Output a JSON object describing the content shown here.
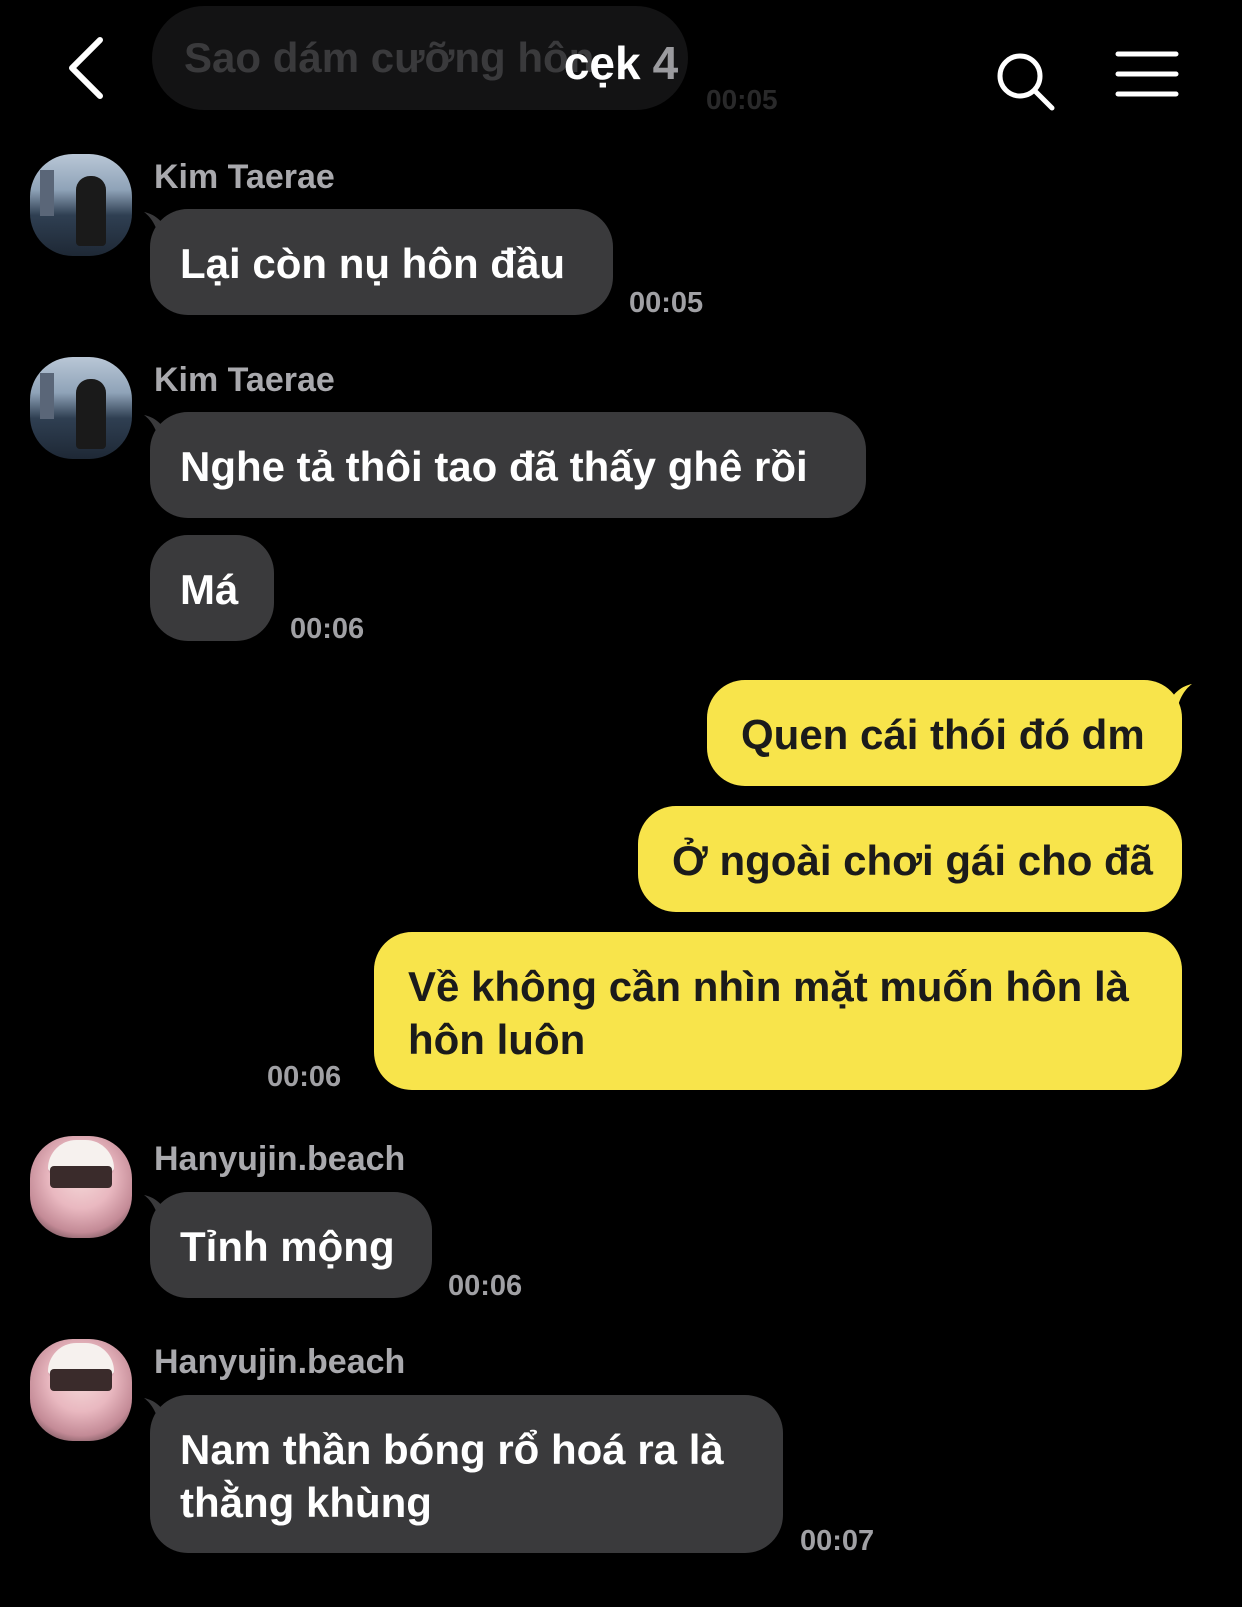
{
  "header": {
    "title": "cẹk",
    "member_count": "4",
    "back_icon": "chevron-left-icon",
    "search_icon": "search-icon",
    "menu_icon": "hamburger-menu-icon"
  },
  "ghost_message": {
    "text": "Sao dám cưỡng hôn",
    "time": "00:05"
  },
  "messages": [
    {
      "sender": "Kim Taerae",
      "text": "Lại còn nụ hôn đầu",
      "time": "00:05"
    },
    {
      "sender": "Kim Taerae",
      "text": "Nghe tả thôi tao đã thấy ghê rồi"
    },
    {
      "text": "Má",
      "time": "00:06"
    },
    {
      "text": "Quen cái thói đó dm"
    },
    {
      "text": "Ở ngoài chơi gái cho đã"
    },
    {
      "line1": "Về không cần nhìn mặt muốn hôn là",
      "line2": "hôn luôn",
      "time": "00:06"
    },
    {
      "sender": "Hanyujin.beach",
      "text": "Tỉnh mộng",
      "time": "00:06"
    },
    {
      "sender": "Hanyujin.beach",
      "line1": "Nam thần bóng rổ hoá ra là",
      "line2": "thằng khùng",
      "time": "00:07"
    }
  ],
  "colors": {
    "background": "#000000",
    "incoming_bubble": "#3a3a3c",
    "outgoing_bubble": "#f8e44b",
    "timestamp": "#a0a0a4",
    "sender_name": "#a9a9ad"
  }
}
